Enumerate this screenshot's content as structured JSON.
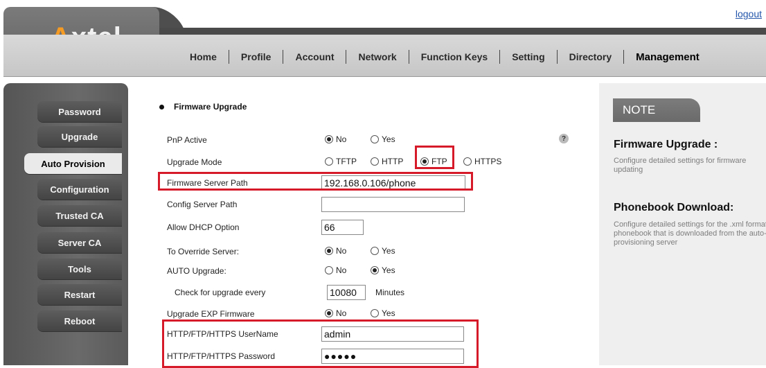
{
  "header": {
    "logo_first": "A",
    "logo_rest": "xtel",
    "logout": "logout",
    "nav": [
      "Home",
      "Profile",
      "Account",
      "Network",
      "Function Keys",
      "Setting",
      "Directory",
      "Management"
    ],
    "active_nav": "Management"
  },
  "sidebar": {
    "items": [
      "Password",
      "Upgrade",
      "Auto Provision",
      "Configuration",
      "Trusted CA",
      "Server CA",
      "Tools",
      "Restart",
      "Reboot"
    ],
    "active": "Auto Provision"
  },
  "main": {
    "section_title": "Firmware Upgrade",
    "pnp_active": {
      "label": "PnP Active",
      "options": [
        "No",
        "Yes"
      ],
      "selected": "No"
    },
    "upgrade_mode": {
      "label": "Upgrade Mode",
      "options": [
        "TFTP",
        "HTTP",
        "FTP",
        "HTTPS"
      ],
      "selected": "FTP"
    },
    "firmware_server_path": {
      "label": "Firmware Server Path",
      "value": "192.168.0.106/phone"
    },
    "config_server_path": {
      "label": "Config Server Path",
      "value": ""
    },
    "allow_dhcp_option": {
      "label": "Allow DHCP Option",
      "value": "66"
    },
    "override_server": {
      "label": "To Override Server:",
      "options": [
        "No",
        "Yes"
      ],
      "selected": "No"
    },
    "auto_upgrade": {
      "label": "AUTO Upgrade:",
      "options": [
        "No",
        "Yes"
      ],
      "selected": "Yes"
    },
    "check_upgrade": {
      "label": "Check for upgrade every",
      "value": "10080",
      "unit": "Minutes"
    },
    "upgrade_exp": {
      "label": "Upgrade EXP Firmware",
      "options": [
        "No",
        "Yes"
      ],
      "selected": "No"
    },
    "username": {
      "label": "HTTP/FTP/HTTPS UserName",
      "value": "admin"
    },
    "password": {
      "label": "HTTP/FTP/HTTPS Password",
      "value": "●●●●●"
    },
    "help_icon": "?"
  },
  "note": {
    "tab": "NOTE",
    "h1": "Firmware Upgrade :",
    "p1": "Configure detailed settings for firmware updating",
    "h2": "Phonebook Download:",
    "p2": "Configure detailed settings for the .xml format phonebook that is downloaded from the auto-provisioning server"
  },
  "colors": {
    "highlight": "#d61a2a",
    "logo_accent": "#f59a23"
  }
}
